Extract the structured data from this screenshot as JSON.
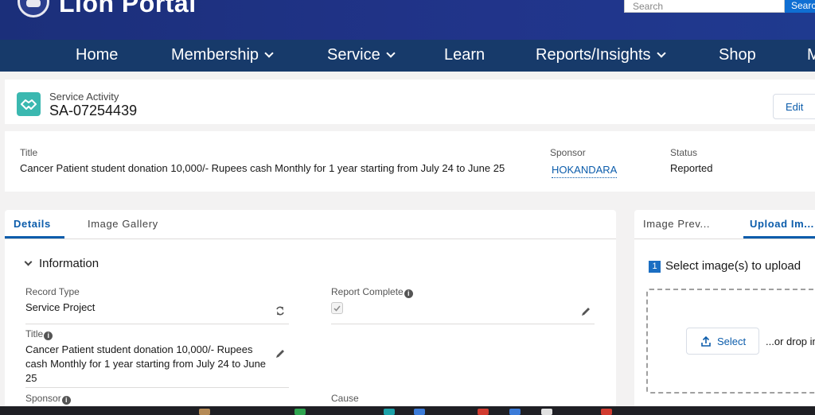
{
  "header": {
    "portal_title": "Lion Portal",
    "search_placeholder": "Search",
    "search_button": "Search"
  },
  "nav": {
    "items": [
      {
        "label": "Home"
      },
      {
        "label": "Membership"
      },
      {
        "label": "Service"
      },
      {
        "label": "Learn"
      },
      {
        "label": "Reports/Insights"
      },
      {
        "label": "Shop"
      },
      {
        "label": "M"
      }
    ]
  },
  "record": {
    "type": "Service Activity",
    "number": "SA-07254439",
    "edit_label": "Edit"
  },
  "highlights": {
    "title_label": "Title",
    "title_value": "Cancer Patient student donation 10,000/- Rupees cash Monthly for 1 year starting from July 24 to June 25",
    "sponsor_label": "Sponsor",
    "sponsor_value": "HOKANDARA",
    "status_label": "Status",
    "status_value": "Reported"
  },
  "details": {
    "tabs": [
      {
        "label": "Details"
      },
      {
        "label": "Image Gallery"
      }
    ],
    "section_title": "Information",
    "record_type_label": "Record Type",
    "record_type_value": "Service Project",
    "report_complete_label": "Report Complete",
    "title_label": "Title",
    "title_value": "Cancer Patient student donation 10,000/- Rupees cash Monthly for 1 year starting from July 24 to June 25",
    "sponsor_label": "Sponsor",
    "cause_label": "Cause"
  },
  "right_panel": {
    "tabs": [
      {
        "label": "Image Prev..."
      },
      {
        "label": "Upload Im..."
      }
    ],
    "step_number": "1",
    "step_label": "Select image(s) to upload",
    "select_button": "Select",
    "drop_text": "...or drop in"
  },
  "colors": {
    "header_bg": "#1b2f7a",
    "nav_bg": "#173a6a",
    "accent": "#0b5cab",
    "record_icon": "#3bb8b0"
  }
}
